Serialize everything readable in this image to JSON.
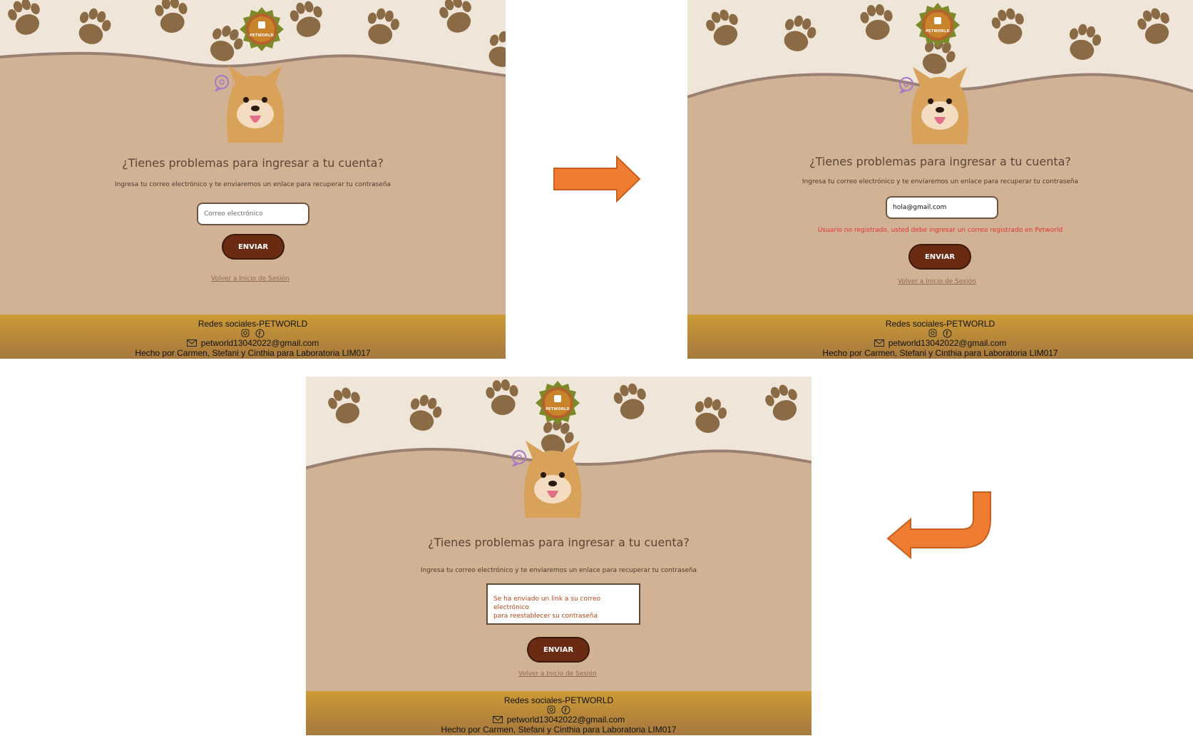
{
  "brand": {
    "logo_text": "PETWORLD"
  },
  "form": {
    "title": "¿Tienes problemas para ingresar a tu cuenta?",
    "subtitle": "Ingresa tu correo electrónico y te enviaremos un enlace para recuperar tu contraseña",
    "email_placeholder": "Correo electrónico",
    "submit_label": "ENVIAR",
    "back_link": "Volver a Inicio de Sesión"
  },
  "state_filled": {
    "email_value": "hola@gmail.com",
    "error_message": "Usuario no registrado, usted debe ingresar un correo registrado en Petworld"
  },
  "state_success": {
    "message_line1": "Se ha enviado un link a su correo electrónico",
    "message_line2": "para reestablecer su contraseña"
  },
  "footer": {
    "social_title": "Redes sociales-PETWORLD",
    "email": "petworld13042022@gmail.com",
    "credits": "Hecho por Carmen, Stefani y Cinthia para Laboratoria LIM017"
  },
  "icons": [
    "paw-icon",
    "instagram-icon",
    "facebook-icon",
    "mail-icon",
    "chat-icon",
    "arrow-right-icon",
    "arrow-return-icon"
  ],
  "colors": {
    "background": "#d2b294",
    "cream": "#efe6d9",
    "paw": "#8b6b45",
    "button": "#6b2b12",
    "footer": "#cc9a36",
    "arrow": "#ee7d31",
    "error": "#e03535"
  }
}
